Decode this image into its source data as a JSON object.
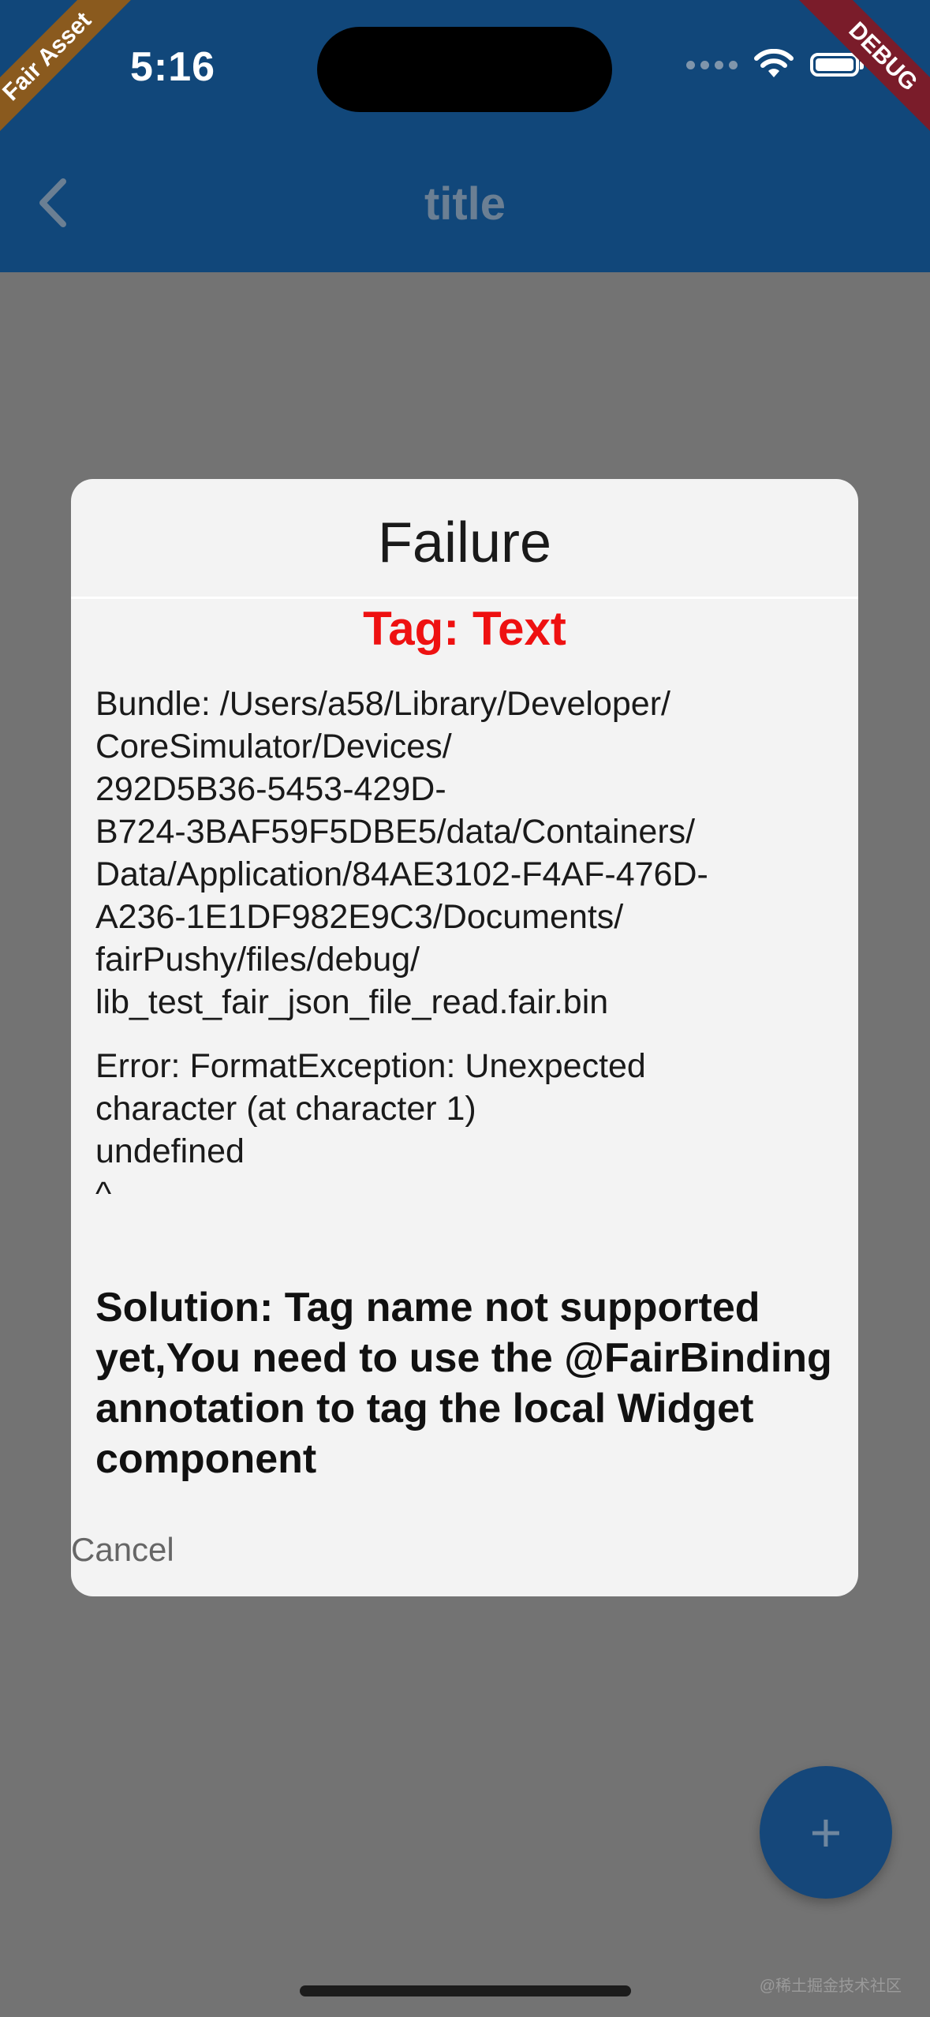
{
  "status_bar": {
    "time": "5:16"
  },
  "ribbons": {
    "left": "Fair Asset",
    "right": "DEBUG"
  },
  "appbar": {
    "title": "title",
    "back_icon": "chevron-left-icon"
  },
  "dialog": {
    "title": "Failure",
    "tag": "Tag: Text",
    "bundle": "Bundle: /Users/a58/Library/Developer/\nCoreSimulator/Devices/\n292D5B36-5453-429D-\nB724-3BAF59F5DBE5/data/Containers/\nData/Application/84AE3102-F4AF-476D-\nA236-1E1DF982E9C3/Documents/\nfairPushy/files/debug/\nlib_test_fair_json_file_read.fair.bin",
    "error": "Error: FormatException: Unexpected\ncharacter (at character 1)\nundefined\n^",
    "solution": "Solution: Tag name not supported yet,You need to use the @FairBinding annotation to tag the local Widget component",
    "cancel_label": "Cancel"
  },
  "fab": {
    "icon": "plus-icon"
  },
  "watermark": "@稀土掘金技术社区",
  "colors": {
    "appbar": "#11477a",
    "scrim": "#737373",
    "dialog_bg": "#f3f3f3",
    "tag_red": "#ee1111",
    "fab": "#15477a"
  }
}
